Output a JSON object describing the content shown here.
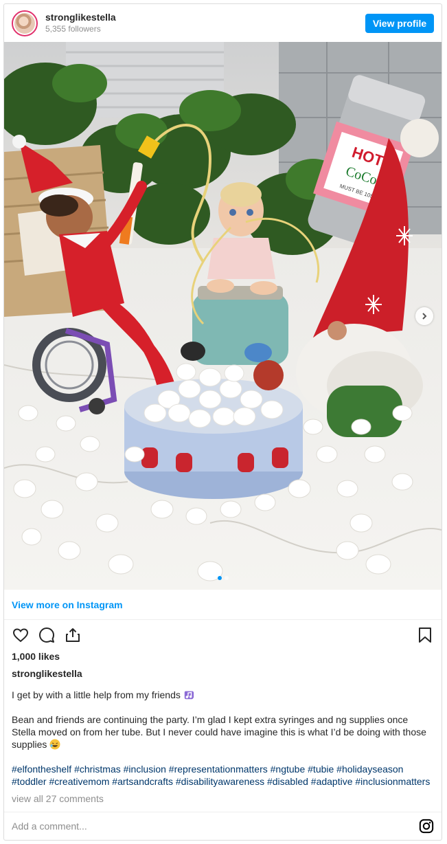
{
  "post": {
    "username": "stronglikestella",
    "followers": "5,355 followers",
    "view_profile_label": "View profile",
    "view_more_label": "View more on Instagram",
    "likes": "1,000 likes",
    "author": "stronglikestella",
    "caption_line1": "I get by with a little help from my friends",
    "caption_line2": "Bean and friends are continuing the party. I’m glad I kept extra syringes and ng supplies once Stella moved on from her tube. But I never could have imagine this is what I’d be doing with those supplies",
    "hashtags": "#elfontheshelf #christmas #inclusion #representationmatters #ngtube #tubie #holidayseason #toddler #creativemom #artsandcrafts #disabilityawareness #disabled #adaptive #inclusionmatters",
    "comments_link": "view all 27 comments",
    "comment_placeholder": "Add a comment...",
    "photo_sign": {
      "line1": "HOT",
      "line2": "CoCo",
      "line3": "MUST BE 10$"
    },
    "carousel": {
      "total": 2,
      "current": 1
    }
  },
  "icons": [
    "avatar",
    "heart-icon",
    "comment-icon",
    "share-icon",
    "bookmark-icon",
    "chevron-right-icon",
    "instagram-icon",
    "music-notes-emoji",
    "laughing-emoji"
  ],
  "colors": {
    "accent": "#0095f6",
    "hashtag": "#00376b",
    "muted": "#8e8e8e",
    "text": "#262626"
  }
}
